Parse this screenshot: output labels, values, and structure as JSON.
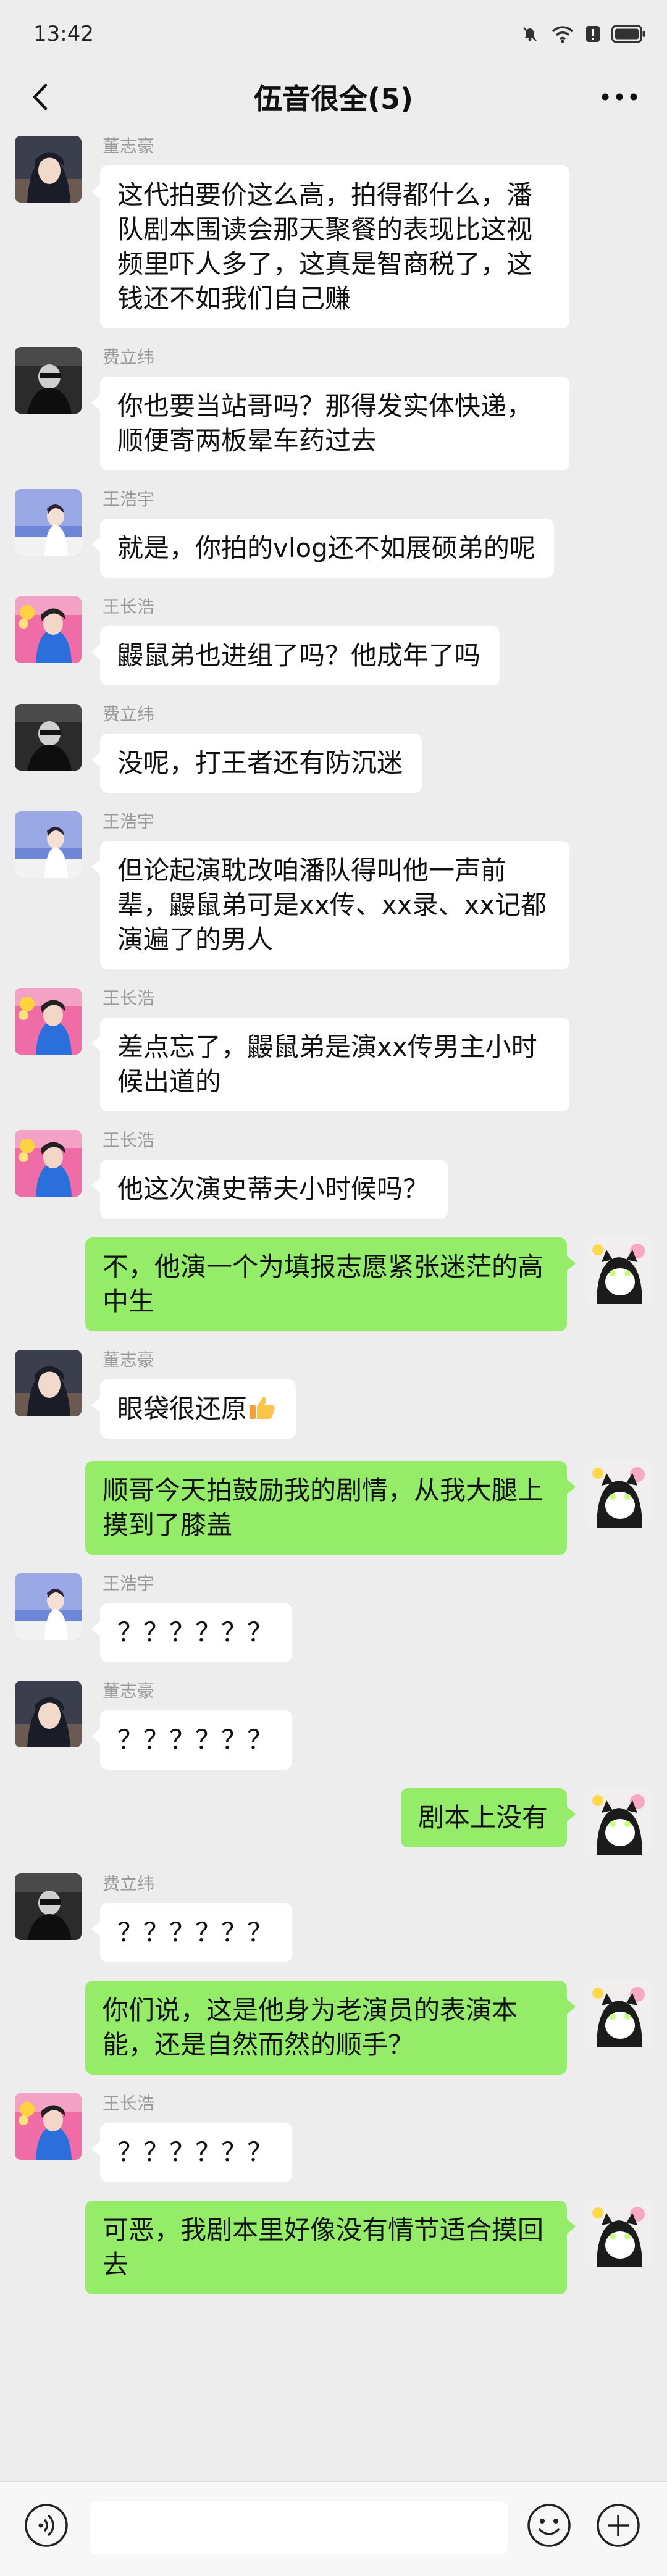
{
  "status": {
    "time": "13:42"
  },
  "header": {
    "title": "伍音很全(5)"
  },
  "messages": [
    {
      "side": "left",
      "sender": "董志豪",
      "avatar": "avatar-dongzhihao",
      "text": "这代拍要价这么高，拍得都什么，潘队剧本围读会那天聚餐的表现比这视频里吓人多了，这真是智商税了，这钱还不如我们自己赚"
    },
    {
      "side": "left",
      "sender": "费立纬",
      "avatar": "avatar-feiliwei",
      "text": "你也要当站哥吗？那得发实体快递，顺便寄两板晕车药过去"
    },
    {
      "side": "left",
      "sender": "王浩宇",
      "avatar": "avatar-wanghaoyu",
      "text": "就是，你拍的vlog还不如展硕弟的呢"
    },
    {
      "side": "left",
      "sender": "王长浩",
      "avatar": "avatar-wangchanghao",
      "text": "鼹鼠弟也进组了吗？他成年了吗"
    },
    {
      "side": "left",
      "sender": "费立纬",
      "avatar": "avatar-feiliwei",
      "text": "没呢，打王者还有防沉迷"
    },
    {
      "side": "left",
      "sender": "王浩宇",
      "avatar": "avatar-wanghaoyu",
      "text": "但论起演耽改咱潘队得叫他一声前辈，鼹鼠弟可是xx传、xx录、xx记都演遍了的男人"
    },
    {
      "side": "left",
      "sender": "王长浩",
      "avatar": "avatar-wangchanghao",
      "text": "差点忘了，鼹鼠弟是演xx传男主小时候出道的"
    },
    {
      "side": "left",
      "sender": "王长浩",
      "avatar": "avatar-wangchanghao",
      "text": "他这次演史蒂夫小时候吗？"
    },
    {
      "side": "right",
      "sender": "",
      "avatar": "avatar-me",
      "text": "不，他演一个为填报志愿紧张迷茫的高中生"
    },
    {
      "side": "left",
      "sender": "董志豪",
      "avatar": "avatar-dongzhihao",
      "text": "眼袋很还原",
      "emoji": "thumbs-up-emoji"
    },
    {
      "side": "right",
      "sender": "",
      "avatar": "avatar-me",
      "text": "顺哥今天拍鼓励我的剧情，从我大腿上摸到了膝盖"
    },
    {
      "side": "left",
      "sender": "王浩宇",
      "avatar": "avatar-wanghaoyu",
      "text": "？？？？？？"
    },
    {
      "side": "left",
      "sender": "董志豪",
      "avatar": "avatar-dongzhihao",
      "text": "？？？？？？"
    },
    {
      "side": "right",
      "sender": "",
      "avatar": "avatar-me",
      "text": "剧本上没有"
    },
    {
      "side": "left",
      "sender": "费立纬",
      "avatar": "avatar-feiliwei",
      "text": "？？？？？？"
    },
    {
      "side": "right",
      "sender": "",
      "avatar": "avatar-me",
      "text": "你们说，这是他身为老演员的表演本能，还是自然而然的顺手？"
    },
    {
      "side": "left",
      "sender": "王长浩",
      "avatar": "avatar-wangchanghao",
      "text": "？？？？？？"
    },
    {
      "side": "right",
      "sender": "",
      "avatar": "avatar-me",
      "text": "可恶，我剧本里好像没有情节适合摸回去"
    }
  ],
  "icons": {
    "back": "chevron-left-icon",
    "more": "more-dots-icon",
    "voice": "voice-icon",
    "emoji": "emoji-icon",
    "plus": "plus-icon"
  },
  "colors": {
    "background": "#ededed",
    "outgoing_bubble": "#95ec69",
    "incoming_bubble": "#ffffff",
    "sender_name": "#9a9a9a"
  }
}
